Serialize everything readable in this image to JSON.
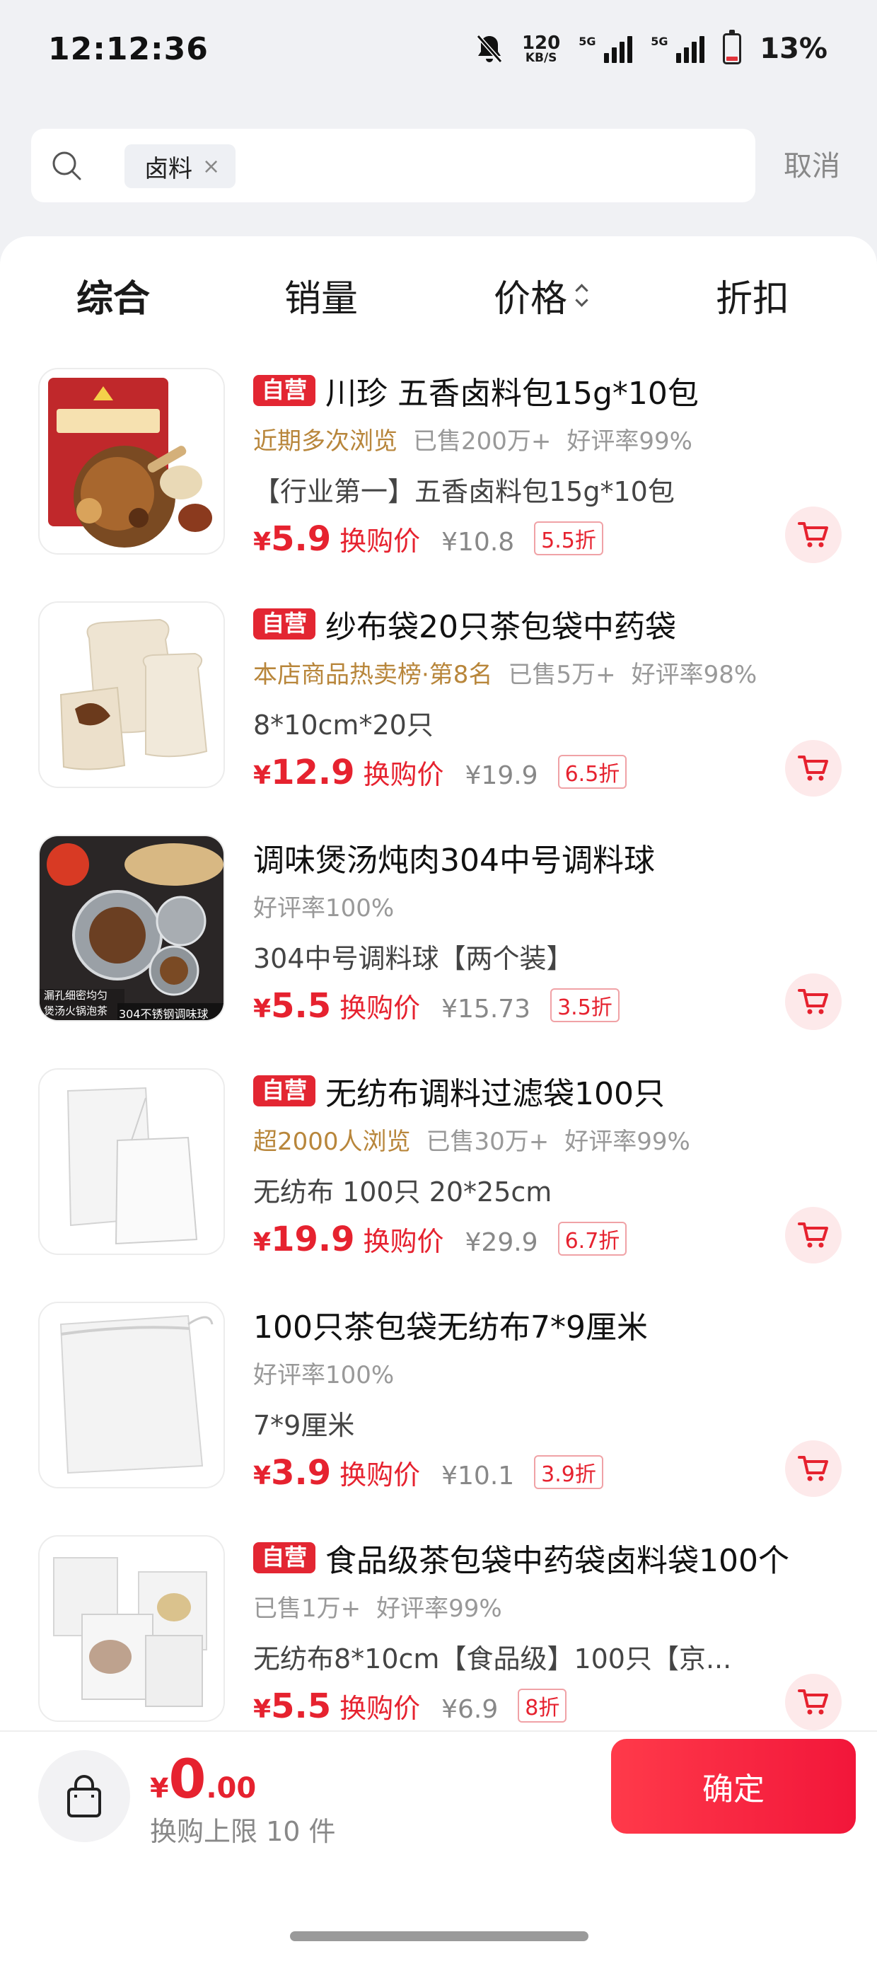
{
  "status_bar": {
    "time": "12:12:36",
    "net_speed_value": "120",
    "net_speed_unit": "KB/S",
    "signal1_label": "5G",
    "signal2_label": "5G",
    "battery": "13%"
  },
  "search": {
    "keyword": "卤料",
    "clear_glyph": "×",
    "cancel_label": "取消"
  },
  "sort_tabs": [
    {
      "label": "综合",
      "active": true
    },
    {
      "label": "销量",
      "active": false
    },
    {
      "label": "价格",
      "active": false
    },
    {
      "label": "折扣",
      "active": false
    }
  ],
  "products": [
    {
      "badge": "自营",
      "title": "川珍 五香卤料包15g*10包",
      "meta_highlight": "近期多次浏览",
      "meta": [
        "已售200万+",
        "好评率99%"
      ],
      "spec": "【行业第一】五香卤料包15g*10包",
      "currency": "¥",
      "price": "5.9",
      "price_label": "换购价",
      "original": "¥10.8",
      "discount": "5.5折",
      "thumb": "spice-pack"
    },
    {
      "badge": "自营",
      "title": "纱布袋20只茶包袋中药袋",
      "meta_highlight": "本店商品热卖榜·第8名",
      "meta": [
        "已售5万+",
        "好评率98%"
      ],
      "spec": "8*10cm*20只",
      "currency": "¥",
      "price": "12.9",
      "price_label": "换购价",
      "original": "¥19.9",
      "discount": "6.5折",
      "thumb": "gauze-bag"
    },
    {
      "badge": "",
      "title": "调味煲汤炖肉304中号调料球",
      "meta_highlight": "",
      "meta": [
        "好评率100%"
      ],
      "spec": "304中号调料球【两个装】",
      "currency": "¥",
      "price": "5.5",
      "price_label": "换购价",
      "original": "¥15.73",
      "discount": "3.5折",
      "thumb": "steel-ball",
      "thumb_caption1": "漏孔细密均匀",
      "thumb_caption2": "煲汤火锅泡茶",
      "thumb_caption3": "304不锈钢调味球"
    },
    {
      "badge": "自营",
      "title": "无纺布调料过滤袋100只",
      "meta_highlight": "超2000人浏览",
      "meta": [
        "已售30万+",
        "好评率99%"
      ],
      "spec": "无纺布 100只 20*25cm",
      "currency": "¥",
      "price": "19.9",
      "price_label": "换购价",
      "original": "¥29.9",
      "discount": "6.7折",
      "thumb": "filter-bag"
    },
    {
      "badge": "",
      "title": "100只茶包袋无纺布7*9厘米",
      "meta_highlight": "",
      "meta": [
        "好评率100%"
      ],
      "spec": "7*9厘米",
      "currency": "¥",
      "price": "3.9",
      "price_label": "换购价",
      "original": "¥10.1",
      "discount": "3.9折",
      "thumb": "tea-bag"
    },
    {
      "badge": "自营",
      "title": "食品级茶包袋中药袋卤料袋100个",
      "meta_highlight": "",
      "meta": [
        "已售1万+",
        "好评率99%"
      ],
      "spec": "无纺布8*10cm【食品级】100只【京...",
      "currency": "¥",
      "price": "5.5",
      "price_label": "换购价",
      "original": "¥6.9",
      "discount": "8折",
      "thumb": "food-bags"
    }
  ],
  "bottom_bar": {
    "currency": "¥",
    "total_int": "0",
    "total_dec": ".00",
    "limit_text": "换购上限 10 件",
    "confirm_label": "确定"
  },
  "colors": {
    "accent": "#e6222f",
    "highlight": "#b8863b",
    "badge_bg": "#e32632"
  },
  "icons": [
    "bell-off-icon",
    "signal-icon",
    "battery-icon",
    "search-icon",
    "clear-icon",
    "sort-arrows-icon",
    "cart-icon",
    "shopping-bag-icon"
  ]
}
